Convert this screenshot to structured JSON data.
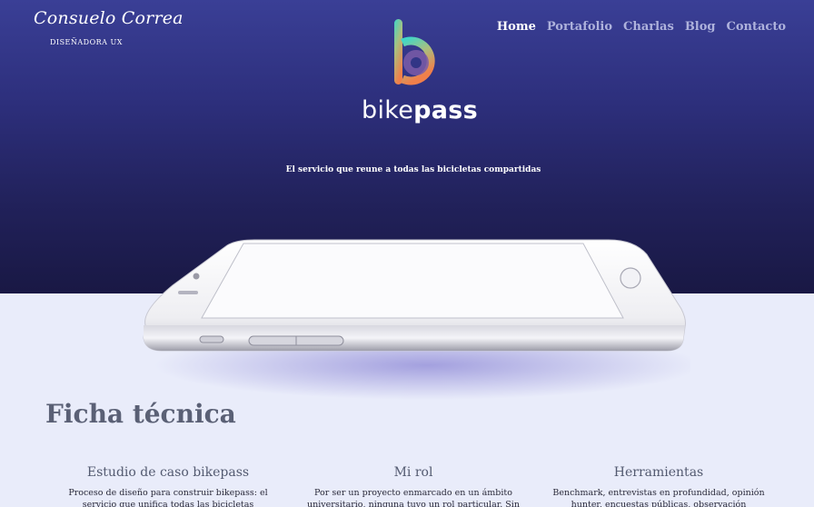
{
  "brand": {
    "signature": "Consuelo Correa",
    "role": "DISEÑADORA UX"
  },
  "nav": {
    "items": [
      {
        "label": "Home",
        "active": true
      },
      {
        "label": "Portafolio",
        "active": false
      },
      {
        "label": "Charlas",
        "active": false
      },
      {
        "label": "Blog",
        "active": false
      },
      {
        "label": "Contacto",
        "active": false
      }
    ]
  },
  "hero": {
    "logo_icon": "bikepass-b-logo-icon",
    "logo_text_light": "bike",
    "logo_text_bold": "pass",
    "tagline": "El servicio que reune a todas las bicicletas compartidas",
    "image": "phone-mockup-image"
  },
  "ficha": {
    "title": "Ficha técnica",
    "columns": [
      {
        "heading": "Estudio de caso bikepass",
        "text": "Proceso de diseño para construir bikepass: el servicio que unifica todas las bicicletas compartidas de la"
      },
      {
        "heading": "Mi rol",
        "text": "Por ser un proyecto enmarcado en un ámbito universitario, ninguna tuvo un rol particular. Sin"
      },
      {
        "heading": "Herramientas",
        "text": "Benchmark, entrevistas en profundidad, opinión hunter, encuestas públicas, observación participante y"
      }
    ]
  },
  "colors": {
    "hero_top": "#3a3f96",
    "hero_bottom": "#191844",
    "page_bg": "#e9ecfa",
    "nav_inactive": "#aeb2dc",
    "title_text": "#5a6075"
  }
}
